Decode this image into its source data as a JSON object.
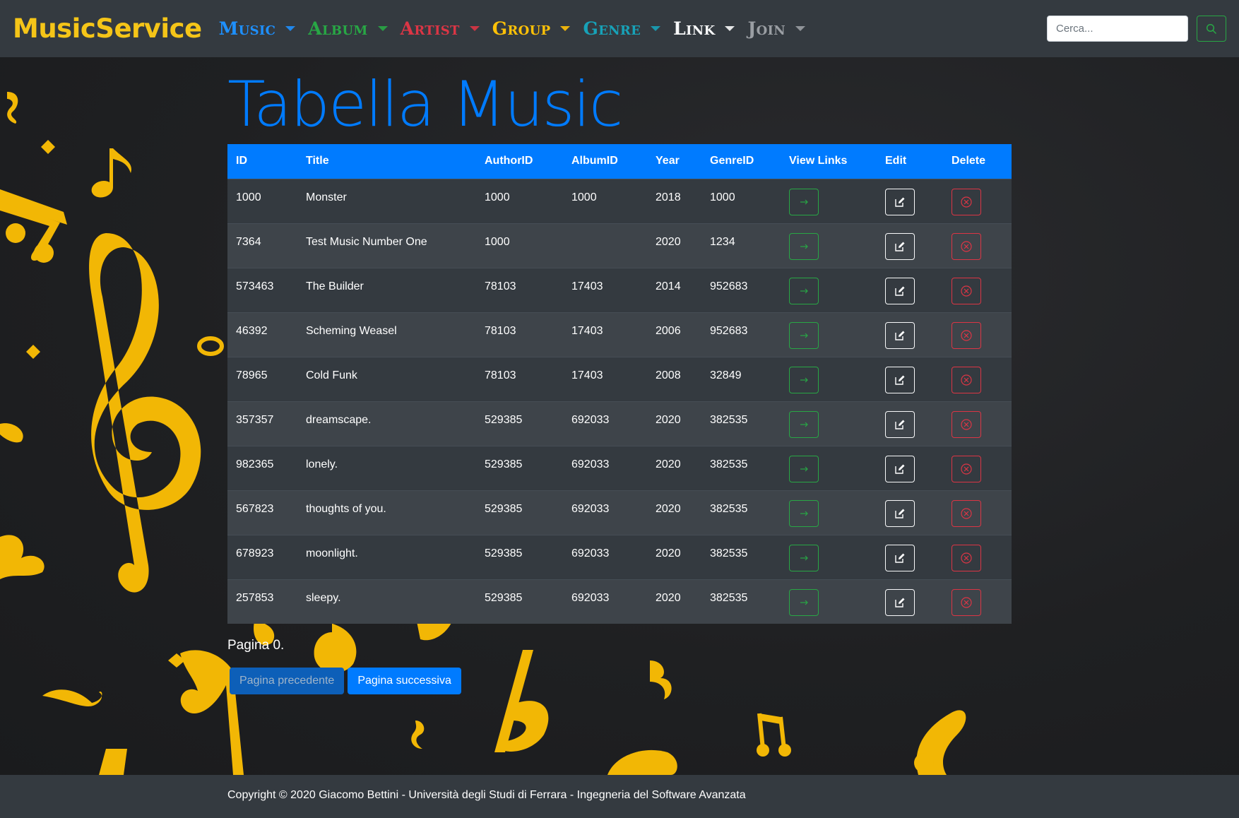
{
  "navbar": {
    "brand": "MusicService",
    "menu": [
      {
        "label": "Music",
        "color": "#1e90ff"
      },
      {
        "label": "Album",
        "color": "#28a745"
      },
      {
        "label": "Artist",
        "color": "#dc3545"
      },
      {
        "label": "Group",
        "color": "#ffc107"
      },
      {
        "label": "Genre",
        "color": "#17a2b8"
      },
      {
        "label": "Link",
        "color": "#f8f9fa"
      },
      {
        "label": "Join",
        "color": "#9a9ea3"
      }
    ],
    "search_placeholder": "Cerca..."
  },
  "main": {
    "title": "Tabella Music",
    "columns": [
      "ID",
      "Title",
      "AuthorID",
      "AlbumID",
      "Year",
      "GenreID",
      "View Links",
      "Edit",
      "Delete"
    ],
    "rows": [
      {
        "id": "1000",
        "title": "Monster",
        "author": "1000",
        "album": "1000",
        "year": "2018",
        "genre": "1000"
      },
      {
        "id": "7364",
        "title": "Test Music Number One",
        "author": "1000",
        "album": "",
        "year": "2020",
        "genre": "1234"
      },
      {
        "id": "573463",
        "title": "The Builder",
        "author": "78103",
        "album": "17403",
        "year": "2014",
        "genre": "952683"
      },
      {
        "id": "46392",
        "title": "Scheming Weasel",
        "author": "78103",
        "album": "17403",
        "year": "2006",
        "genre": "952683"
      },
      {
        "id": "78965",
        "title": "Cold Funk",
        "author": "78103",
        "album": "17403",
        "year": "2008",
        "genre": "32849"
      },
      {
        "id": "357357",
        "title": "dreamscape.",
        "author": "529385",
        "album": "692033",
        "year": "2020",
        "genre": "382535"
      },
      {
        "id": "982365",
        "title": "lonely.",
        "author": "529385",
        "album": "692033",
        "year": "2020",
        "genre": "382535"
      },
      {
        "id": "567823",
        "title": "thoughts of you.",
        "author": "529385",
        "album": "692033",
        "year": "2020",
        "genre": "382535"
      },
      {
        "id": "678923",
        "title": "moonlight.",
        "author": "529385",
        "album": "692033",
        "year": "2020",
        "genre": "382535"
      },
      {
        "id": "257853",
        "title": "sleepy.",
        "author": "529385",
        "album": "692033",
        "year": "2020",
        "genre": "382535"
      }
    ],
    "page_text": "Pagina 0.",
    "prev_label": "Pagina precedente",
    "next_label": "Pagina successiva"
  },
  "footer": {
    "text": "Copyright © 2020 Giacomo Bettini - Università degli Studi di Ferrara - Ingegneria del Software Avanzata"
  },
  "colors": {
    "accent": "#007bff",
    "brand": "#f5c518",
    "view_button": "#28a745",
    "delete_button": "#dc3545",
    "background_notes": "#f2b705"
  },
  "icons": {
    "search": "search-icon",
    "view": "arrow-right-icon",
    "edit": "edit-icon",
    "delete": "close-circle-icon",
    "caret": "caret-down-icon"
  }
}
